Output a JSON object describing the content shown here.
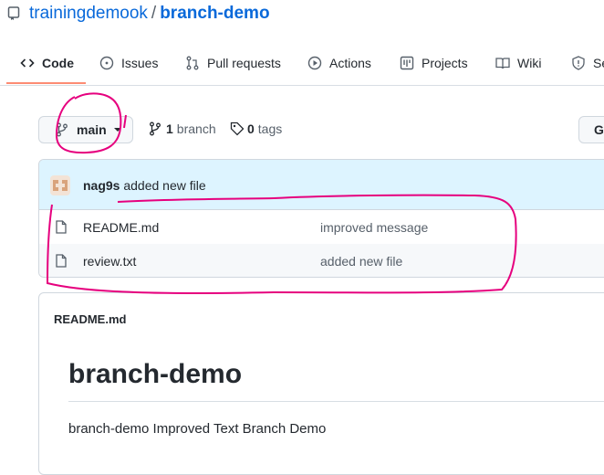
{
  "repo": {
    "owner": "trainingdemook",
    "separator": "/",
    "name": "branch-demo"
  },
  "tabs": [
    {
      "label": "Code",
      "icon": "code-icon"
    },
    {
      "label": "Issues",
      "icon": "issue-opened-icon"
    },
    {
      "label": "Pull requests",
      "icon": "git-pull-request-icon"
    },
    {
      "label": "Actions",
      "icon": "play-icon"
    },
    {
      "label": "Projects",
      "icon": "project-icon"
    },
    {
      "label": "Wiki",
      "icon": "book-icon"
    },
    {
      "label": "Se",
      "icon": "shield-icon"
    }
  ],
  "branch": {
    "current": "main",
    "count": "1",
    "count_label": "branch",
    "tag_count": "0",
    "tag_label": "tags"
  },
  "right_button": {
    "label": "G"
  },
  "commit": {
    "author": "nag9s",
    "message": "added new file"
  },
  "files": [
    {
      "name": "README.md",
      "message": "improved message"
    },
    {
      "name": "review.txt",
      "message": "added new file"
    }
  ],
  "readme": {
    "title": "README.md",
    "heading": "branch-demo",
    "text": "branch-demo Improved Text Branch Demo"
  },
  "colors": {
    "link": "#0969da",
    "accent": "#fd8c73",
    "annotation": "#e6007e",
    "commit_bg": "#ddf4ff"
  }
}
